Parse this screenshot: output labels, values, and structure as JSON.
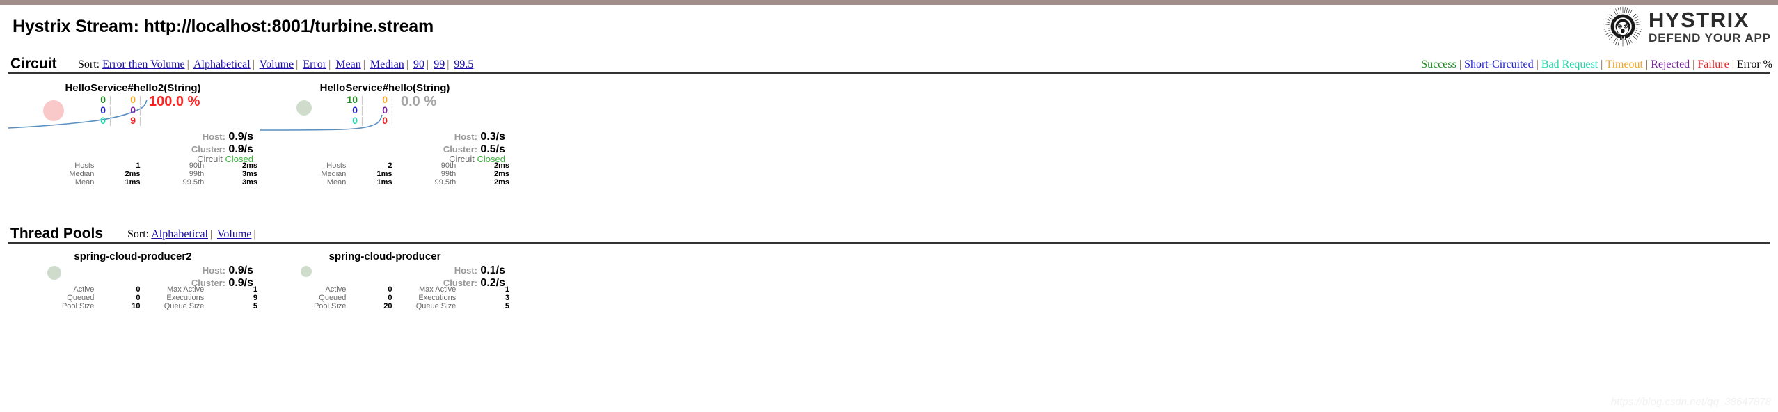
{
  "header": {
    "stream_title": "Hystrix Stream: http://localhost:8001/turbine.stream",
    "logo_name": "HYSTRIX",
    "logo_tagline": "DEFEND YOUR APP",
    "logo_icon": "hystrix-porcupine-logo"
  },
  "circuit_section": {
    "title": "Circuit",
    "sort_label": "Sort:",
    "sort_links": [
      "Error then Volume",
      "Alphabetical",
      "Volume",
      "Error",
      "Mean",
      "Median",
      "90",
      "99",
      "99.5"
    ],
    "legend": [
      {
        "label": "Success",
        "color": "#1d8a1d"
      },
      {
        "label": "Short-Circuited",
        "color": "#2020d0"
      },
      {
        "label": "Bad Request",
        "color": "#1fd6a8"
      },
      {
        "label": "Timeout",
        "color": "#f5a623"
      },
      {
        "label": "Rejected",
        "color": "#7b1fa2"
      },
      {
        "label": "Failure",
        "color": "#e82020"
      },
      {
        "label": "Error %",
        "color": "#000000"
      }
    ]
  },
  "circuits": [
    {
      "name": "HelloService#hello2(String)",
      "counters": {
        "success": "0",
        "timeout": "0",
        "short_circuited": "0",
        "rejected": "0",
        "bad_request": "0",
        "failure": "9"
      },
      "error_percent": "100.0 %",
      "error_state": "high",
      "host_label": "Host:",
      "host_rate": "0.9/s",
      "cluster_label": "Cluster:",
      "cluster_rate": "0.9/s",
      "circuit_label": "Circuit",
      "circuit_state": "Closed",
      "marker_color": "#f9c9c9",
      "marker_size": 30,
      "stats": [
        {
          "label": "Hosts",
          "value": "1",
          "label2": "90th",
          "value2": "2ms"
        },
        {
          "label": "Median",
          "value": "2ms",
          "label2": "99th",
          "value2": "3ms"
        },
        {
          "label": "Mean",
          "value": "1ms",
          "label2": "99.5th",
          "value2": "3ms"
        }
      ]
    },
    {
      "name": "HelloService#hello(String)",
      "counters": {
        "success": "10",
        "timeout": "0",
        "short_circuited": "0",
        "rejected": "0",
        "bad_request": "0",
        "failure": "0"
      },
      "error_percent": "0.0 %",
      "error_state": "zero",
      "host_label": "Host:",
      "host_rate": "0.3/s",
      "cluster_label": "Cluster:",
      "cluster_rate": "0.5/s",
      "circuit_label": "Circuit",
      "circuit_state": "Closed",
      "marker_color": "#cfdccb",
      "marker_size": 22,
      "stats": [
        {
          "label": "Hosts",
          "value": "2",
          "label2": "90th",
          "value2": "2ms"
        },
        {
          "label": "Median",
          "value": "1ms",
          "label2": "99th",
          "value2": "2ms"
        },
        {
          "label": "Mean",
          "value": "1ms",
          "label2": "99.5th",
          "value2": "2ms"
        }
      ]
    }
  ],
  "threadpool_section": {
    "title": "Thread Pools",
    "sort_label": "Sort:",
    "sort_links": [
      "Alphabetical",
      "Volume"
    ]
  },
  "threadpools": [
    {
      "name": "spring-cloud-producer2",
      "host_label": "Host:",
      "host_rate": "0.9/s",
      "cluster_label": "Cluster:",
      "cluster_rate": "0.9/s",
      "marker_color": "#cfdccb",
      "marker_size": 20,
      "stats": [
        {
          "label": "Active",
          "value": "0",
          "label2": "Max Active",
          "value2": "1"
        },
        {
          "label": "Queued",
          "value": "0",
          "label2": "Executions",
          "value2": "9"
        },
        {
          "label": "Pool Size",
          "value": "10",
          "label2": "Queue Size",
          "value2": "5"
        }
      ]
    },
    {
      "name": "spring-cloud-producer",
      "host_label": "Host:",
      "host_rate": "0.1/s",
      "cluster_label": "Cluster:",
      "cluster_rate": "0.2/s",
      "marker_color": "#cfdccb",
      "marker_size": 16,
      "stats": [
        {
          "label": "Active",
          "value": "0",
          "label2": "Max Active",
          "value2": "1"
        },
        {
          "label": "Queued",
          "value": "0",
          "label2": "Executions",
          "value2": "3"
        },
        {
          "label": "Pool Size",
          "value": "20",
          "label2": "Queue Size",
          "value2": "5"
        }
      ]
    }
  ],
  "watermark": "https://blog.csdn.net/qq_38647878"
}
